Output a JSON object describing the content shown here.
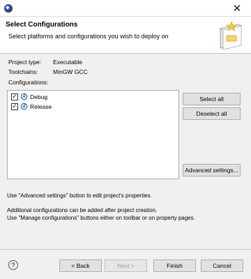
{
  "window": {
    "close_glyph": "✕"
  },
  "header": {
    "title": "Select Configurations",
    "description": "Select platforms and configurations you wish to deploy on"
  },
  "info": {
    "project_type_label": "Project type:",
    "project_type_value": "Executable",
    "toolchains_label": "Toolchains:",
    "toolchains_value": "MinGW GCC",
    "configurations_label": "Configurations:"
  },
  "configurations": [
    {
      "label": "Debug",
      "checked": true
    },
    {
      "label": "Release",
      "checked": true
    }
  ],
  "side_buttons": {
    "select_all": "Select all",
    "deselect_all": "Deselect all",
    "advanced": "Advanced settings..."
  },
  "messages": {
    "line1": "Use \"Advanced settings\" button to edit project's properties.",
    "line2": "Additional configurations can be added after project creation.",
    "line3": "Use \"Manage configurations\" buttons either on toolbar or on property pages."
  },
  "footer": {
    "back": "< Back",
    "next": "Next >",
    "finish": "Finish",
    "cancel": "Cancel"
  },
  "colors": {
    "accent": "#0078d7"
  }
}
